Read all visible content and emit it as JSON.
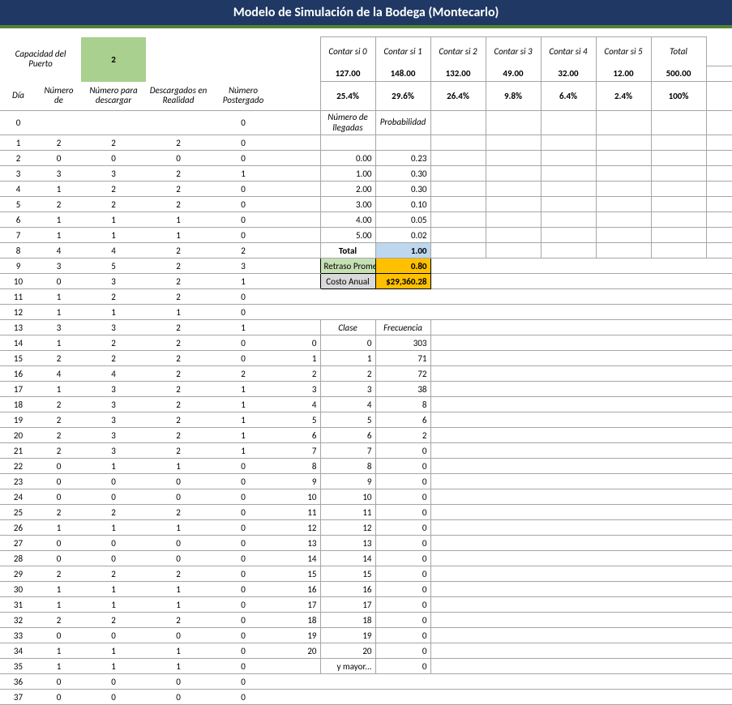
{
  "title": "Modelo de Simulación de la Bodega (Montecarlo)",
  "cap_label": "Capacidad del Puerto",
  "cap_value": "2",
  "left_headers": {
    "dia": "Día",
    "num_llegada": "Número de",
    "num_descargar": "Número para descargar",
    "desc_realidad": "Descargados en Realidad",
    "num_postergado": "Número Postergado"
  },
  "left_rows": [
    {
      "d": "0",
      "a": "",
      "b": "",
      "c": "",
      "p": "0"
    },
    {
      "d": "1",
      "a": "2",
      "b": "2",
      "c": "2",
      "p": "0"
    },
    {
      "d": "2",
      "a": "0",
      "b": "0",
      "c": "0",
      "p": "0"
    },
    {
      "d": "3",
      "a": "3",
      "b": "3",
      "c": "2",
      "p": "1"
    },
    {
      "d": "4",
      "a": "1",
      "b": "2",
      "c": "2",
      "p": "0"
    },
    {
      "d": "5",
      "a": "2",
      "b": "2",
      "c": "2",
      "p": "0"
    },
    {
      "d": "6",
      "a": "1",
      "b": "1",
      "c": "1",
      "p": "0"
    },
    {
      "d": "7",
      "a": "1",
      "b": "1",
      "c": "1",
      "p": "0"
    },
    {
      "d": "8",
      "a": "4",
      "b": "4",
      "c": "2",
      "p": "2"
    },
    {
      "d": "9",
      "a": "3",
      "b": "5",
      "c": "2",
      "p": "3"
    },
    {
      "d": "10",
      "a": "0",
      "b": "3",
      "c": "2",
      "p": "1"
    },
    {
      "d": "11",
      "a": "1",
      "b": "2",
      "c": "2",
      "p": "0"
    },
    {
      "d": "12",
      "a": "1",
      "b": "1",
      "c": "1",
      "p": "0"
    },
    {
      "d": "13",
      "a": "3",
      "b": "3",
      "c": "2",
      "p": "1"
    },
    {
      "d": "14",
      "a": "1",
      "b": "2",
      "c": "2",
      "p": "0"
    },
    {
      "d": "15",
      "a": "2",
      "b": "2",
      "c": "2",
      "p": "0"
    },
    {
      "d": "16",
      "a": "4",
      "b": "4",
      "c": "2",
      "p": "2"
    },
    {
      "d": "17",
      "a": "1",
      "b": "3",
      "c": "2",
      "p": "1"
    },
    {
      "d": "18",
      "a": "2",
      "b": "3",
      "c": "2",
      "p": "1"
    },
    {
      "d": "19",
      "a": "2",
      "b": "3",
      "c": "2",
      "p": "1"
    },
    {
      "d": "20",
      "a": "2",
      "b": "3",
      "c": "2",
      "p": "1"
    },
    {
      "d": "21",
      "a": "2",
      "b": "3",
      "c": "2",
      "p": "1"
    },
    {
      "d": "22",
      "a": "0",
      "b": "1",
      "c": "1",
      "p": "0"
    },
    {
      "d": "23",
      "a": "0",
      "b": "0",
      "c": "0",
      "p": "0"
    },
    {
      "d": "24",
      "a": "0",
      "b": "0",
      "c": "0",
      "p": "0"
    },
    {
      "d": "25",
      "a": "2",
      "b": "2",
      "c": "2",
      "p": "0"
    },
    {
      "d": "26",
      "a": "1",
      "b": "1",
      "c": "1",
      "p": "0"
    },
    {
      "d": "27",
      "a": "0",
      "b": "0",
      "c": "0",
      "p": "0"
    },
    {
      "d": "28",
      "a": "0",
      "b": "0",
      "c": "0",
      "p": "0"
    },
    {
      "d": "29",
      "a": "2",
      "b": "2",
      "c": "2",
      "p": "0"
    },
    {
      "d": "30",
      "a": "1",
      "b": "1",
      "c": "1",
      "p": "0"
    },
    {
      "d": "31",
      "a": "1",
      "b": "1",
      "c": "1",
      "p": "0"
    },
    {
      "d": "32",
      "a": "2",
      "b": "2",
      "c": "2",
      "p": "0"
    },
    {
      "d": "33",
      "a": "0",
      "b": "0",
      "c": "0",
      "p": "0"
    },
    {
      "d": "34",
      "a": "1",
      "b": "1",
      "c": "1",
      "p": "0"
    },
    {
      "d": "35",
      "a": "1",
      "b": "1",
      "c": "1",
      "p": "0"
    },
    {
      "d": "36",
      "a": "0",
      "b": "0",
      "c": "0",
      "p": "0"
    },
    {
      "d": "37",
      "a": "0",
      "b": "0",
      "c": "0",
      "p": "0"
    }
  ],
  "count_headers": [
    "Contar si 0",
    "Contar si 1",
    "Contar si 2",
    "Contar si 3",
    "Contar si 4",
    "Contar si 5",
    "Total"
  ],
  "count_values": [
    "127.00",
    "148.00",
    "132.00",
    "49.00",
    "32.00",
    "12.00",
    "500.00"
  ],
  "count_pct": [
    "25.4%",
    "29.6%",
    "26.4%",
    "9.8%",
    "6.4%",
    "2.4%",
    "100%"
  ],
  "prob_head": {
    "num": "Número de llegadas",
    "prob": "Probabilidad"
  },
  "prob_rows": [
    {
      "n": "0.00",
      "p": "0.23"
    },
    {
      "n": "1.00",
      "p": "0.30"
    },
    {
      "n": "2.00",
      "p": "0.30"
    },
    {
      "n": "3.00",
      "p": "0.10"
    },
    {
      "n": "4.00",
      "p": "0.05"
    },
    {
      "n": "5.00",
      "p": "0.02"
    }
  ],
  "prob_total_label": "Total",
  "prob_total_value": "1.00",
  "retraso_label": "Retraso Promedi",
  "retraso_value": "0.80",
  "costo_label": "Costo Anual",
  "costo_value": "$29,360.28",
  "freq_head": {
    "clase": "Clase",
    "freq": "Frecuencia"
  },
  "freq_rows": [
    {
      "i": "0",
      "c": "0",
      "f": "303"
    },
    {
      "i": "1",
      "c": "1",
      "f": "71"
    },
    {
      "i": "2",
      "c": "2",
      "f": "72"
    },
    {
      "i": "3",
      "c": "3",
      "f": "38"
    },
    {
      "i": "4",
      "c": "4",
      "f": "8"
    },
    {
      "i": "5",
      "c": "5",
      "f": "6"
    },
    {
      "i": "6",
      "c": "6",
      "f": "2"
    },
    {
      "i": "7",
      "c": "7",
      "f": "0"
    },
    {
      "i": "8",
      "c": "8",
      "f": "0"
    },
    {
      "i": "9",
      "c": "9",
      "f": "0"
    },
    {
      "i": "10",
      "c": "10",
      "f": "0"
    },
    {
      "i": "11",
      "c": "11",
      "f": "0"
    },
    {
      "i": "12",
      "c": "12",
      "f": "0"
    },
    {
      "i": "13",
      "c": "13",
      "f": "0"
    },
    {
      "i": "14",
      "c": "14",
      "f": "0"
    },
    {
      "i": "15",
      "c": "15",
      "f": "0"
    },
    {
      "i": "16",
      "c": "16",
      "f": "0"
    },
    {
      "i": "17",
      "c": "17",
      "f": "0"
    },
    {
      "i": "18",
      "c": "18",
      "f": "0"
    },
    {
      "i": "19",
      "c": "19",
      "f": "0"
    },
    {
      "i": "20",
      "c": "20",
      "f": "0"
    }
  ],
  "freq_more_label": "y mayor...",
  "freq_more_value": "0"
}
